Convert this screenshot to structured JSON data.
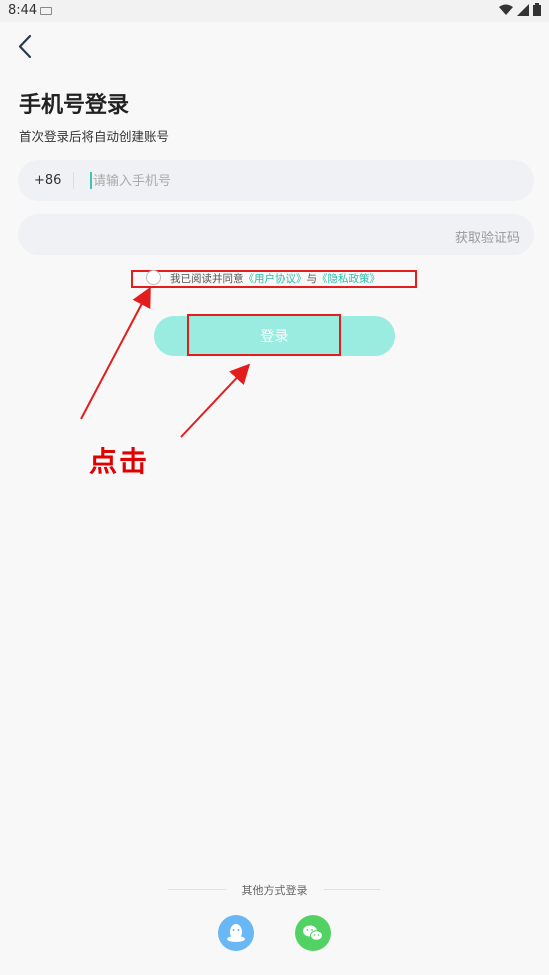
{
  "status_bar": {
    "time": "8:44"
  },
  "header": {
    "title": "手机号登录",
    "subtitle": "首次登录后将自动创建账号"
  },
  "phone": {
    "country_code": "+86",
    "placeholder": "请输入手机号",
    "value": ""
  },
  "code": {
    "placeholder": "",
    "get_code_label": "获取验证码"
  },
  "agreement": {
    "prefix": "我已阅读并同意",
    "user_agreement": "《用户协议》",
    "and": "与",
    "privacy_policy": "《隐私政策》",
    "checked": false
  },
  "login_button": {
    "label": "登录"
  },
  "annotation": {
    "click_label": "点击",
    "color": "#e31c1c"
  },
  "other_login": {
    "label": "其他方式登录",
    "methods": [
      {
        "name": "qq",
        "icon": "qq-icon",
        "color": "#69b7f5"
      },
      {
        "name": "wechat",
        "icon": "wechat-icon",
        "color": "#52d262"
      }
    ]
  },
  "colors": {
    "accent": "#2fbcab",
    "button": "#9aebe0",
    "background": "#f8f8f9"
  }
}
